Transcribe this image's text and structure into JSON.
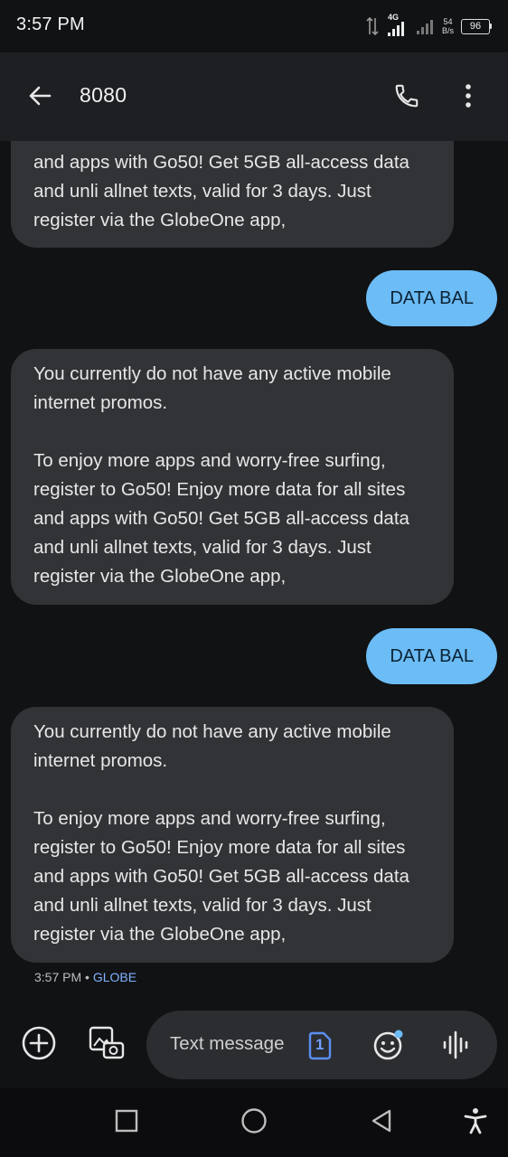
{
  "status_bar": {
    "time": "3:57 PM",
    "network": "4G",
    "speed_value": "54",
    "speed_unit": "B/s",
    "battery": "96"
  },
  "header": {
    "title": "8080",
    "back_icon": "arrow-left-icon",
    "call_icon": "phone-icon",
    "more_icon": "more-vert-icon"
  },
  "messages": [
    {
      "direction": "incoming",
      "paragraphs": [
        "and apps with Go50! Get 5GB all-access data and unli allnet texts, valid for 3 days. Just register via the GlobeOne app,"
      ]
    },
    {
      "direction": "outgoing",
      "text": "DATA BAL"
    },
    {
      "direction": "incoming",
      "paragraphs": [
        "You currently do not have any active mobile internet promos.",
        "To enjoy more apps and worry-free surfing, register to Go50! Enjoy more data for all sites and apps with Go50! Get 5GB all-access data and unli allnet texts, valid for 3 days. Just register via the GlobeOne app,"
      ]
    },
    {
      "direction": "outgoing",
      "text": "DATA BAL"
    },
    {
      "direction": "incoming",
      "paragraphs": [
        "You currently do not have any active mobile internet promos.",
        "To enjoy more apps and worry-free surfing, register to Go50! Enjoy more data for all sites and apps with Go50! Get 5GB all-access data and unli allnet texts, valid for 3 days. Just register via the GlobeOne app,"
      ]
    }
  ],
  "last_meta": {
    "time": "3:57 PM",
    "separator": "•",
    "sim": "GLOBE"
  },
  "composer": {
    "placeholder": "Text message",
    "sim_slot": "1"
  },
  "colors": {
    "background": "#111214",
    "app_bar": "#1e1f22",
    "incoming_bubble": "#323337",
    "outgoing_bubble": "#6cbcf6",
    "sim_accent": "#7fb2ff"
  }
}
